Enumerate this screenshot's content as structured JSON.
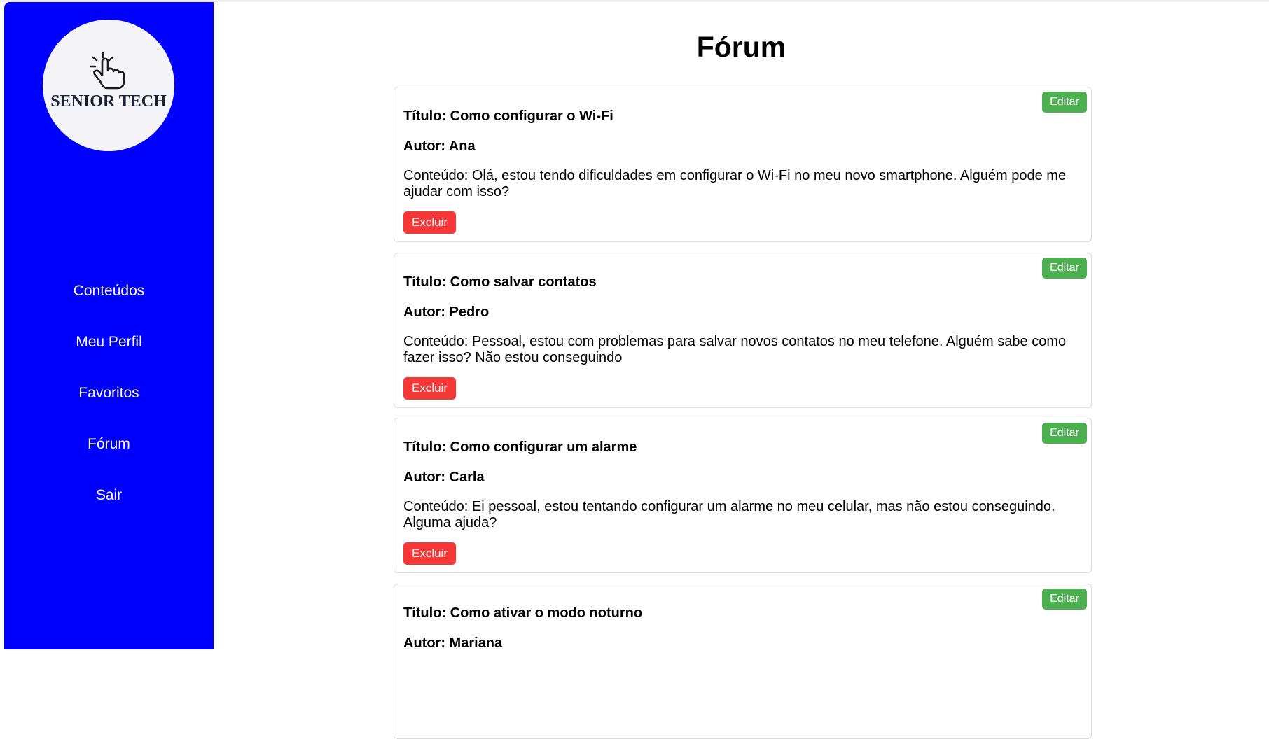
{
  "sidebar": {
    "logo_text": "SENIOR TECH",
    "logo_icon": "tap-hand-icon",
    "color": "#0000ff",
    "nav": [
      "Conteúdos",
      "Meu Perfil",
      "Favoritos",
      "Fórum",
      "Sair"
    ]
  },
  "page": {
    "title": "Fórum"
  },
  "actions": {
    "edit_label": "Editar",
    "delete_label": "Excluir",
    "edit_color": "#4caf50",
    "delete_color": "#f53737"
  },
  "posts": [
    {
      "title": "Título: Como configurar o Wi-Fi",
      "author": "Autor: Ana",
      "content": "Conteúdo: Olá, estou tendo dificuldades em configurar o Wi-Fi no meu novo smartphone. Alguém pode me ajudar com isso?"
    },
    {
      "title": "Título: Como salvar contatos",
      "author": "Autor: Pedro",
      "content": "Conteúdo: Pessoal, estou com problemas para salvar novos contatos no meu telefone. Alguém sabe como fazer isso? Não estou conseguindo"
    },
    {
      "title": "Título: Como configurar um alarme",
      "author": "Autor: Carla",
      "content": "Conteúdo: Ei pessoal, estou tentando configurar um alarme no meu celular, mas não estou conseguindo. Alguma ajuda?"
    },
    {
      "title": "Título: Como ativar o modo noturno",
      "author": "Autor: Mariana",
      "content": ""
    }
  ]
}
